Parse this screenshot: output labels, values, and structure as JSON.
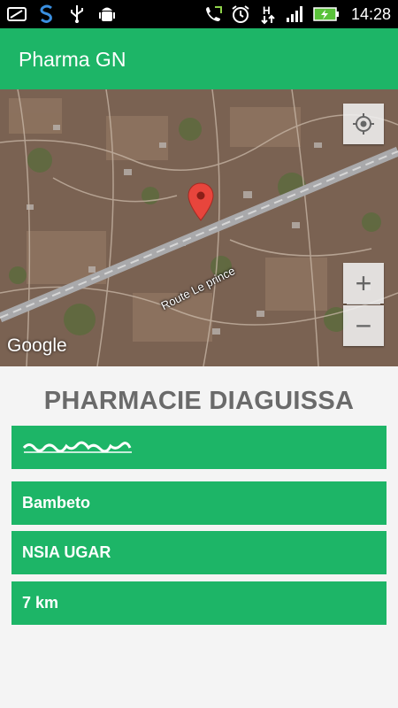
{
  "status_bar": {
    "time": "14:28",
    "left_icons": [
      "screen-cast-icon",
      "s-app-icon",
      "usb-icon",
      "android-debug-icon"
    ],
    "right_icons": [
      "call-forward-icon",
      "alarm-icon",
      "hspa-data-icon",
      "signal-icon",
      "battery-charging-icon"
    ],
    "data_indicator": "H"
  },
  "app_bar": {
    "title": "Pharma GN",
    "color": "#1db567"
  },
  "map": {
    "road_label": "Route Le prince",
    "attribution": "Google",
    "zoom_in_label": "+",
    "zoom_out_label": "−",
    "marker_color": "#e8453c"
  },
  "pharmacy": {
    "name": "PHARMACIE DIAGUISSA",
    "area": "Bambeto",
    "insurer": "NSIA UGAR",
    "distance": "7 km"
  },
  "colors": {
    "accent": "#1db567",
    "name_text": "#6a6a6a",
    "background": "#f4f4f4"
  }
}
